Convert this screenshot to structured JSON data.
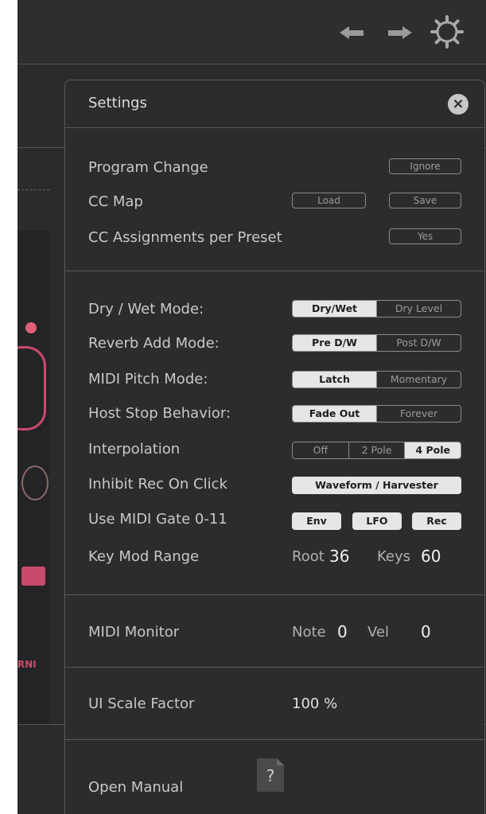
{
  "header": {
    "undo_icon": "undo-arrow-icon",
    "redo_icon": "redo-arrow-icon",
    "settings_icon": "gear-icon"
  },
  "background": {
    "side_text": "RNI"
  },
  "settings": {
    "title": "Settings",
    "close_icon": "close-circle-icon",
    "program_change": {
      "label": "Program Change",
      "button": "Ignore"
    },
    "cc_map": {
      "label": "CC Map",
      "load": "Load",
      "save": "Save"
    },
    "cc_assign": {
      "label": "CC Assignments per Preset",
      "button": "Yes"
    },
    "dry_wet_mode": {
      "label": "Dry / Wet Mode:",
      "options": [
        "Dry/Wet",
        "Dry Level"
      ],
      "selected": "Dry/Wet"
    },
    "reverb_add_mode": {
      "label": "Reverb Add Mode:",
      "options": [
        "Pre D/W",
        "Post D/W"
      ],
      "selected": "Pre D/W"
    },
    "midi_pitch_mode": {
      "label": "MIDI Pitch Mode:",
      "options": [
        "Latch",
        "Momentary"
      ],
      "selected": "Latch"
    },
    "host_stop": {
      "label": "Host Stop Behavior:",
      "options": [
        "Fade Out",
        "Forever"
      ],
      "selected": "Fade Out"
    },
    "interpolation": {
      "label": "Interpolation",
      "options": [
        "Off",
        "2 Pole",
        "4 Pole"
      ],
      "selected": "4 Pole"
    },
    "inhibit_rec": {
      "label": "Inhibit Rec On Click",
      "button": "Waveform / Harvester"
    },
    "midi_gate": {
      "label": "Use MIDI Gate 0-11",
      "env": "Env",
      "lfo": "LFO",
      "rec": "Rec"
    },
    "key_mod": {
      "label": "Key Mod Range",
      "root_label": "Root",
      "root_value": "36",
      "keys_label": "Keys",
      "keys_value": "60"
    },
    "midi_monitor": {
      "label": "MIDI Monitor",
      "note_label": "Note",
      "note_value": "0",
      "vel_label": "Vel",
      "vel_value": "0"
    },
    "ui_scale": {
      "label": "UI Scale Factor",
      "value": "100 %"
    },
    "manual": {
      "label": "Open Manual",
      "icon": "help-document-icon",
      "icon_glyph": "?"
    }
  }
}
